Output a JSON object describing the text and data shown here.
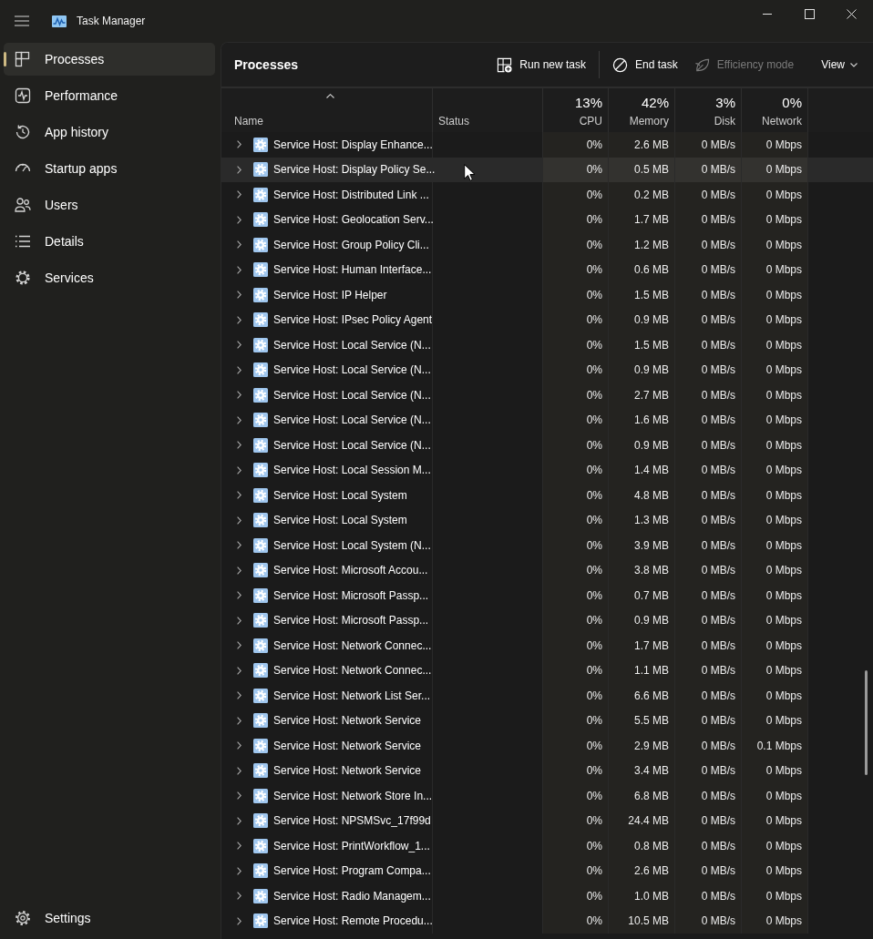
{
  "window": {
    "title": "Task Manager"
  },
  "sidebar": {
    "items": [
      {
        "label": "Processes",
        "selected": true
      },
      {
        "label": "Performance",
        "selected": false
      },
      {
        "label": "App history",
        "selected": false
      },
      {
        "label": "Startup apps",
        "selected": false
      },
      {
        "label": "Users",
        "selected": false
      },
      {
        "label": "Details",
        "selected": false
      },
      {
        "label": "Services",
        "selected": false
      }
    ],
    "footer": {
      "label": "Settings",
      "selected": false
    }
  },
  "page": {
    "title": "Processes"
  },
  "toolbar": {
    "buttons": [
      {
        "label": "Run new task",
        "kind": "action",
        "disabled": false
      },
      {
        "label": "End task",
        "kind": "action",
        "disabled": false
      },
      {
        "label": "Efficiency mode",
        "kind": "action",
        "disabled": true
      },
      {
        "label": "View",
        "kind": "menu",
        "disabled": false
      }
    ]
  },
  "table": {
    "columns": [
      {
        "label": "Name",
        "kind": "text",
        "sorted": true
      },
      {
        "label": "Status",
        "kind": "text",
        "sorted": false
      },
      {
        "label": "CPU",
        "kind": "metric",
        "usage": "13%",
        "sorted": false
      },
      {
        "label": "Memory",
        "kind": "metric",
        "usage": "42%",
        "sorted": false
      },
      {
        "label": "Disk",
        "kind": "metric",
        "usage": "3%",
        "sorted": false
      },
      {
        "label": "Network",
        "kind": "metric",
        "usage": "0%",
        "sorted": false
      }
    ],
    "rows": [
      {
        "name": "Service Host: Display Enhance...",
        "cpu": "0%",
        "memory": "2.6 MB",
        "disk": "0 MB/s",
        "network": "0 Mbps",
        "expanded": false,
        "hovered": false
      },
      {
        "name": "Service Host: Display Policy Se...",
        "cpu": "0%",
        "memory": "0.5 MB",
        "disk": "0 MB/s",
        "network": "0 Mbps",
        "expanded": false,
        "hovered": true
      },
      {
        "name": "Service Host: Distributed Link ...",
        "cpu": "0%",
        "memory": "0.2 MB",
        "disk": "0 MB/s",
        "network": "0 Mbps",
        "expanded": false,
        "hovered": false
      },
      {
        "name": "Service Host: Geolocation Serv...",
        "cpu": "0%",
        "memory": "1.7 MB",
        "disk": "0 MB/s",
        "network": "0 Mbps",
        "expanded": false,
        "hovered": false
      },
      {
        "name": "Service Host: Group Policy Cli...",
        "cpu": "0%",
        "memory": "1.2 MB",
        "disk": "0 MB/s",
        "network": "0 Mbps",
        "expanded": false,
        "hovered": false
      },
      {
        "name": "Service Host: Human Interface...",
        "cpu": "0%",
        "memory": "0.6 MB",
        "disk": "0 MB/s",
        "network": "0 Mbps",
        "expanded": false,
        "hovered": false
      },
      {
        "name": "Service Host: IP Helper",
        "cpu": "0%",
        "memory": "1.5 MB",
        "disk": "0 MB/s",
        "network": "0 Mbps",
        "expanded": false,
        "hovered": false
      },
      {
        "name": "Service Host: IPsec Policy Agent",
        "cpu": "0%",
        "memory": "0.9 MB",
        "disk": "0 MB/s",
        "network": "0 Mbps",
        "expanded": false,
        "hovered": false
      },
      {
        "name": "Service Host: Local Service (N...",
        "cpu": "0%",
        "memory": "1.5 MB",
        "disk": "0 MB/s",
        "network": "0 Mbps",
        "expanded": false,
        "hovered": false
      },
      {
        "name": "Service Host: Local Service (N...",
        "cpu": "0%",
        "memory": "0.9 MB",
        "disk": "0 MB/s",
        "network": "0 Mbps",
        "expanded": false,
        "hovered": false
      },
      {
        "name": "Service Host: Local Service (N...",
        "cpu": "0%",
        "memory": "2.7 MB",
        "disk": "0 MB/s",
        "network": "0 Mbps",
        "expanded": false,
        "hovered": false
      },
      {
        "name": "Service Host: Local Service (N...",
        "cpu": "0%",
        "memory": "1.6 MB",
        "disk": "0 MB/s",
        "network": "0 Mbps",
        "expanded": false,
        "hovered": false
      },
      {
        "name": "Service Host: Local Service (N...",
        "cpu": "0%",
        "memory": "0.9 MB",
        "disk": "0 MB/s",
        "network": "0 Mbps",
        "expanded": false,
        "hovered": false
      },
      {
        "name": "Service Host: Local Session M...",
        "cpu": "0%",
        "memory": "1.4 MB",
        "disk": "0 MB/s",
        "network": "0 Mbps",
        "expanded": false,
        "hovered": false
      },
      {
        "name": "Service Host: Local System",
        "cpu": "0%",
        "memory": "4.8 MB",
        "disk": "0 MB/s",
        "network": "0 Mbps",
        "expanded": false,
        "hovered": false
      },
      {
        "name": "Service Host: Local System",
        "cpu": "0%",
        "memory": "1.3 MB",
        "disk": "0 MB/s",
        "network": "0 Mbps",
        "expanded": false,
        "hovered": false
      },
      {
        "name": "Service Host: Local System (N...",
        "cpu": "0%",
        "memory": "3.9 MB",
        "disk": "0 MB/s",
        "network": "0 Mbps",
        "expanded": false,
        "hovered": false
      },
      {
        "name": "Service Host: Microsoft Accou...",
        "cpu": "0%",
        "memory": "3.8 MB",
        "disk": "0 MB/s",
        "network": "0 Mbps",
        "expanded": false,
        "hovered": false
      },
      {
        "name": "Service Host: Microsoft Passp...",
        "cpu": "0%",
        "memory": "0.7 MB",
        "disk": "0 MB/s",
        "network": "0 Mbps",
        "expanded": false,
        "hovered": false
      },
      {
        "name": "Service Host: Microsoft Passp...",
        "cpu": "0%",
        "memory": "0.9 MB",
        "disk": "0 MB/s",
        "network": "0 Mbps",
        "expanded": false,
        "hovered": false
      },
      {
        "name": "Service Host: Network Connec...",
        "cpu": "0%",
        "memory": "1.7 MB",
        "disk": "0 MB/s",
        "network": "0 Mbps",
        "expanded": false,
        "hovered": false
      },
      {
        "name": "Service Host: Network Connec...",
        "cpu": "0%",
        "memory": "1.1 MB",
        "disk": "0 MB/s",
        "network": "0 Mbps",
        "expanded": false,
        "hovered": false
      },
      {
        "name": "Service Host: Network List Ser...",
        "cpu": "0%",
        "memory": "6.6 MB",
        "disk": "0 MB/s",
        "network": "0 Mbps",
        "expanded": false,
        "hovered": false
      },
      {
        "name": "Service Host: Network Service",
        "cpu": "0%",
        "memory": "5.5 MB",
        "disk": "0 MB/s",
        "network": "0 Mbps",
        "expanded": false,
        "hovered": false
      },
      {
        "name": "Service Host: Network Service",
        "cpu": "0%",
        "memory": "2.9 MB",
        "disk": "0 MB/s",
        "network": "0.1 Mbps",
        "expanded": false,
        "hovered": false
      },
      {
        "name": "Service Host: Network Service",
        "cpu": "0%",
        "memory": "3.4 MB",
        "disk": "0 MB/s",
        "network": "0 Mbps",
        "expanded": false,
        "hovered": false
      },
      {
        "name": "Service Host: Network Store In...",
        "cpu": "0%",
        "memory": "6.8 MB",
        "disk": "0 MB/s",
        "network": "0 Mbps",
        "expanded": false,
        "hovered": false
      },
      {
        "name": "Service Host: NPSMSvc_17f99d",
        "cpu": "0%",
        "memory": "24.4 MB",
        "disk": "0 MB/s",
        "network": "0 Mbps",
        "expanded": false,
        "hovered": false
      },
      {
        "name": "Service Host: PrintWorkflow_1...",
        "cpu": "0%",
        "memory": "0.8 MB",
        "disk": "0 MB/s",
        "network": "0 Mbps",
        "expanded": false,
        "hovered": false
      },
      {
        "name": "Service Host: Program Compa...",
        "cpu": "0%",
        "memory": "2.6 MB",
        "disk": "0 MB/s",
        "network": "0 Mbps",
        "expanded": false,
        "hovered": false
      },
      {
        "name": "Service Host: Radio Managem...",
        "cpu": "0%",
        "memory": "1.0 MB",
        "disk": "0 MB/s",
        "network": "0 Mbps",
        "expanded": false,
        "hovered": false
      },
      {
        "name": "Service Host: Remote Procedu...",
        "cpu": "0%",
        "memory": "10.5 MB",
        "disk": "0 MB/s",
        "network": "0 Mbps",
        "expanded": false,
        "hovered": false
      }
    ]
  }
}
